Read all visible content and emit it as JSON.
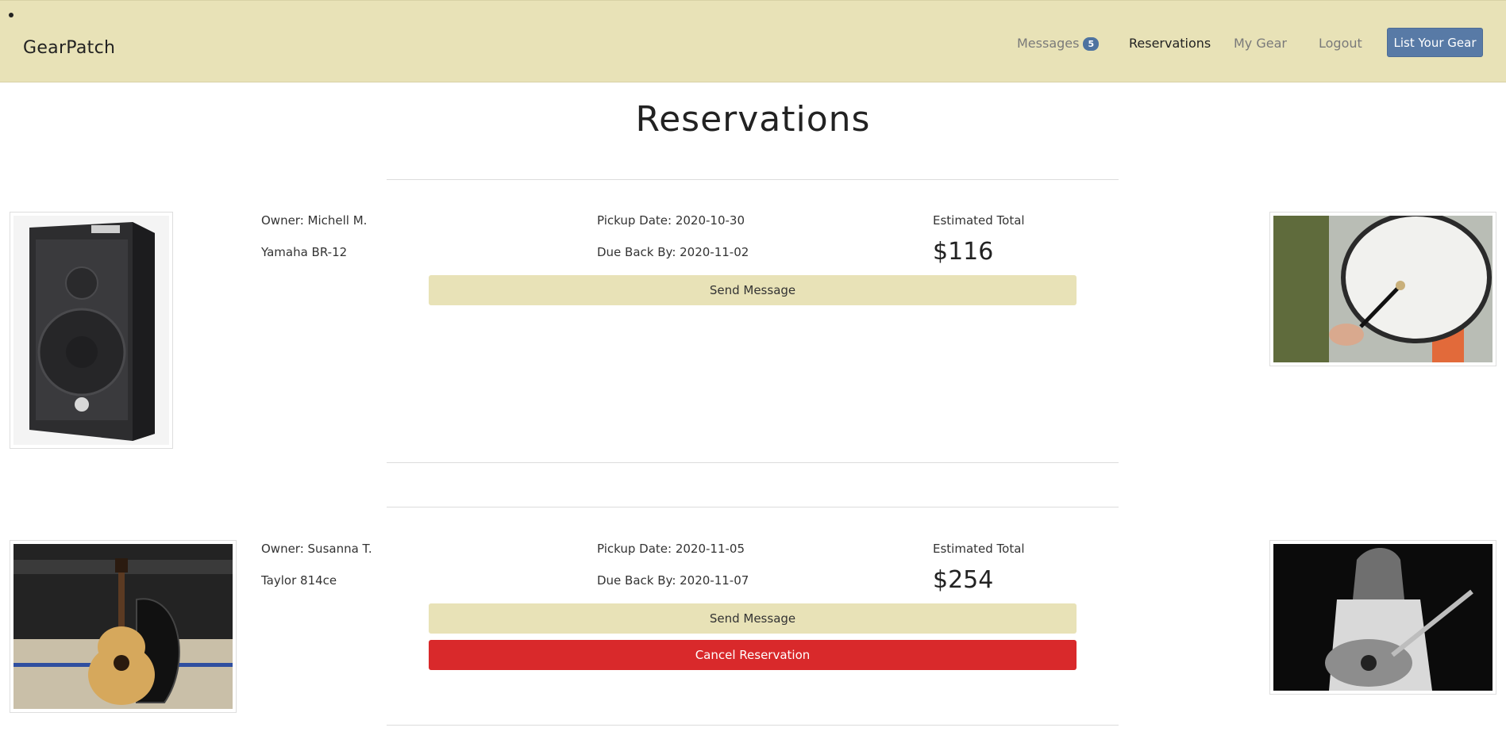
{
  "nav": {
    "brand": "GearPatch",
    "messages_label": "Messages",
    "messages_count": "5",
    "reservations_label": "Reservations",
    "my_gear_label": "My Gear",
    "logout_label": "Logout",
    "list_gear_label": "List Your Gear"
  },
  "page": {
    "title": "Reservations"
  },
  "reservations": [
    {
      "owner": "Owner: Michell M.",
      "item": "Yamaha BR-12",
      "pickup": "Pickup Date: 2020-10-30",
      "due": "Due Back By: 2020-11-02",
      "total_label": "Estimated Total",
      "total": "$116",
      "send_message_label": "Send Message"
    },
    {
      "owner": "Owner: Susanna T.",
      "item": "Taylor 814ce",
      "pickup": "Pickup Date: 2020-11-05",
      "due": "Due Back By: 2020-11-07",
      "total_label": "Estimated Total",
      "total": "$254",
      "send_message_label": "Send Message",
      "cancel_label": "Cancel Reservation"
    }
  ],
  "colors": {
    "navbar_bg": "#e8e2b7",
    "primary_button": "#587aa6",
    "cancel_button": "#d9292b"
  }
}
